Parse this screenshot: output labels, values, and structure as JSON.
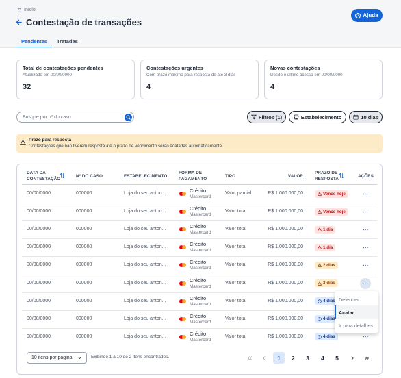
{
  "breadcrumb": {
    "label": "Início"
  },
  "header": {
    "title": "Contestação de transações",
    "help_label": "Ajuda"
  },
  "tabs": [
    {
      "label": "Pendentes",
      "active": true
    },
    {
      "label": "Tratadas",
      "active": false
    }
  ],
  "cards": [
    {
      "title": "Total de contestações pendentes",
      "subtitle": "Atualizado em 00/00/0000",
      "value": "32"
    },
    {
      "title": "Contestações urgentes",
      "subtitle": "Com prazo máximo para resposta de até 3 dias",
      "value": "4"
    },
    {
      "title": "Novas contestações",
      "subtitle": "Desde o último acesso em 00/00/0000",
      "value": "4"
    }
  ],
  "search": {
    "placeholder": "Busque por nº do caso",
    "value": ""
  },
  "filters": {
    "filters_label": "Filtros (1)",
    "store_label": "Estabelecimento",
    "days_label": "10 dias"
  },
  "alert": {
    "title": "Prazo para resposta",
    "text": "Contestações que não tiverem resposta até o prazo de vencimento serão acatadas automaticamente."
  },
  "table": {
    "headers": {
      "date_line1": "DATA DA",
      "date_line2": "CONTESTAÇÃO",
      "case": "Nº DO CASO",
      "store": "ESTABELECIMENTO",
      "payment_line1": "FORMA DE",
      "payment_line2": "PAGAMENTO",
      "type": "TIPO",
      "value": "VALOR",
      "deadline_line1": "PRAZO DE",
      "deadline_line2": "RESPOSTA",
      "actions": "AÇÕES"
    },
    "rows": [
      {
        "date": "00/00/0000",
        "case": "000000",
        "store": "Loja do seu anton...",
        "payment": "Crédito",
        "brand": "Mastercard",
        "type": "Valor parcial",
        "value": "R$ 1.000.000,00",
        "deadline": "Vence hoje",
        "status": "red"
      },
      {
        "date": "00/00/0000",
        "case": "000000",
        "store": "Loja do seu anton...",
        "payment": "Crédito",
        "brand": "Mastercard",
        "type": "Valor total",
        "value": "R$ 1.000.000,00",
        "deadline": "Vence hoje",
        "status": "red"
      },
      {
        "date": "00/00/0000",
        "case": "000000",
        "store": "Loja do seu anton...",
        "payment": "Crédito",
        "brand": "Mastercard",
        "type": "Valor total",
        "value": "R$ 1.000.000,00",
        "deadline": "1 dia",
        "status": "red"
      },
      {
        "date": "00/00/0000",
        "case": "000000",
        "store": "Loja do seu anton...",
        "payment": "Crédito",
        "brand": "Mastercard",
        "type": "Valor total",
        "value": "R$ 1.000.000,00",
        "deadline": "1 dia",
        "status": "red"
      },
      {
        "date": "00/00/0000",
        "case": "000000",
        "store": "Loja do seu anton...",
        "payment": "Crédito",
        "brand": "Mastercard",
        "type": "Valor total",
        "value": "R$ 1.000.000,00",
        "deadline": "2 dias",
        "status": "orange"
      },
      {
        "date": "00/00/0000",
        "case": "000000",
        "store": "Loja do seu anton...",
        "payment": "Crédito",
        "brand": "Mastercard",
        "type": "Valor total",
        "value": "R$ 1.000.000,00",
        "deadline": "3 dias",
        "status": "orange"
      },
      {
        "date": "00/00/0000",
        "case": "000000",
        "store": "Loja do seu anton...",
        "payment": "Crédito",
        "brand": "Mastercard",
        "type": "Valor total",
        "value": "R$ 1.000.000,00",
        "deadline": "4 dias",
        "status": "blue"
      },
      {
        "date": "00/00/0000",
        "case": "000000",
        "store": "Loja do seu anton...",
        "payment": "Crédito",
        "brand": "Mastercard",
        "type": "Valor total",
        "value": "R$ 1.000.000,00",
        "deadline": "4 dias",
        "status": "blue"
      },
      {
        "date": "00/00/0000",
        "case": "000000",
        "store": "Loja do seu anton...",
        "payment": "Crédito",
        "brand": "Mastercard",
        "type": "Valor total",
        "value": "R$ 1.000.000,00",
        "deadline": "4 dias",
        "status": "blue"
      }
    ]
  },
  "action_menu": {
    "items": [
      "Defender",
      "Acatar",
      "Ir para detalhes"
    ],
    "selected": "Acatar"
  },
  "pagination": {
    "per_page_label": "10 itens por página",
    "info": "Exibindo 1 à 10 de 2 itens encontrados.",
    "pages": [
      "1",
      "2",
      "3",
      "4",
      "5"
    ],
    "current": "1"
  },
  "colors": {
    "primary": "#1565d8",
    "alert_bg": "#fdebc8",
    "danger_bg": "#fde2e2",
    "warning_bg": "#fdebc8",
    "info_bg": "#dbeafe"
  }
}
